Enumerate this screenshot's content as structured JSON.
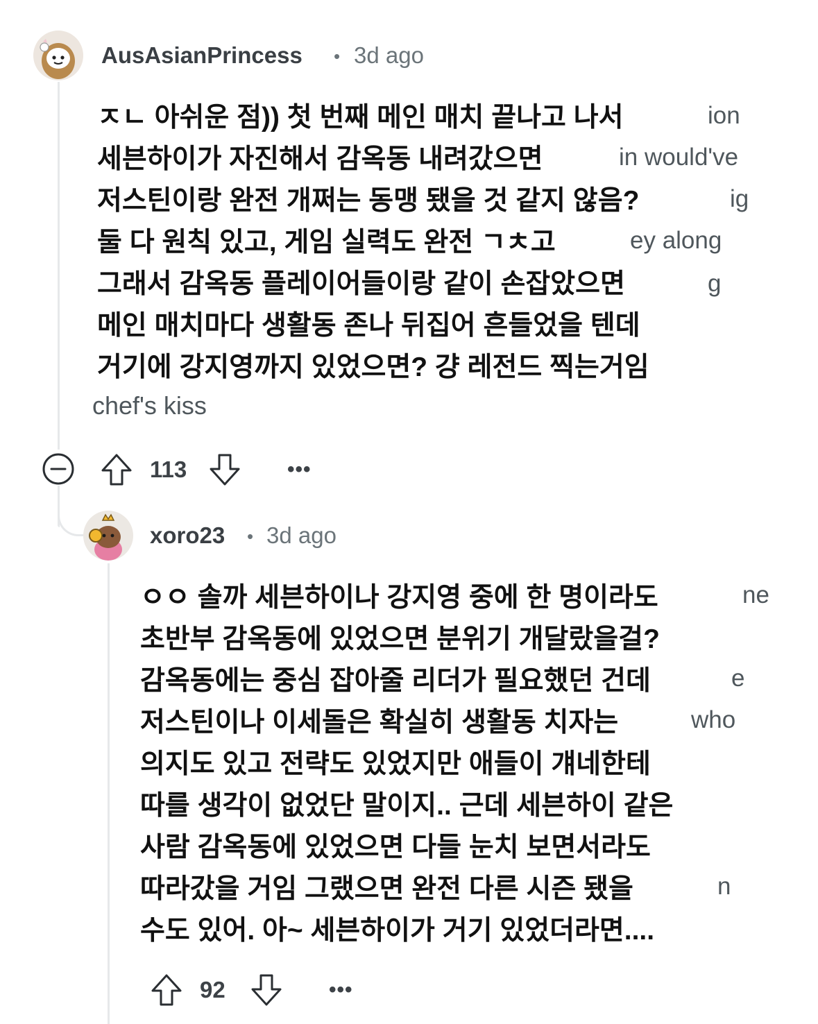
{
  "comments": [
    {
      "author": "AusAsianPrincess",
      "separator": "•",
      "time": "3d ago",
      "body_lines": [
        "ㅈㄴ 아쉬운 점)) 첫 번째 메인 매치 끝나고 나서",
        "세븐하이가 자진해서 감옥동 내려갔으면",
        "저스틴이랑 완전 개쩌는 동맹 됐을 것 같지 않음?",
        "둘 다 원칙 있고, 게임 실력도 완전 ㄱㅊ고",
        "그래서 감옥동 플레이어들이랑 같이 손잡았으면",
        "메인 매치마다 생활동 존나 뒤집어 흔들었을 텐데",
        "거기에 강지영까지 있었으면? 걍 레전드 찍는거임"
      ],
      "ghost_fragments": [
        "ion",
        "in would've",
        "ig",
        "ey along",
        "g"
      ],
      "tail_text": "chef's kiss",
      "upvotes": "113",
      "icons": [
        "collapse-icon",
        "upvote-icon",
        "downvote-icon",
        "more-options-icon"
      ]
    },
    {
      "author": "xoro23",
      "separator": "•",
      "time": "3d ago",
      "body_lines": [
        "ㅇㅇ 솔까 세븐하이나 강지영 중에 한 명이라도",
        "초반부 감옥동에 있었으면 분위기 개달랐을걸?",
        "감옥동에는 중심 잡아줄 리더가 필요했던 건데",
        "저스틴이나 이세돌은 확실히 생활동 치자는",
        "의지도 있고 전략도 있었지만 애들이 걔네한테",
        "따를 생각이 없었단 말이지.. 근데 세븐하이 같은",
        "사람 감옥동에 있었으면 다들 눈치 보면서라도",
        "따라갔을 거임 그랬으면 완전 다른 시즌 됐을",
        "수도 있어. 아~ 세븐하이가 거기 있었더라면...."
      ],
      "ghost_fragments": [
        "ne",
        "e",
        "who",
        "n"
      ],
      "upvotes": "92",
      "icons": [
        "upvote-icon",
        "downvote-icon",
        "more-options-icon"
      ]
    }
  ],
  "more_label": "•••",
  "colors": {
    "thread_line": "#e6e8ea",
    "meta": "#6b7479",
    "text": "#111111"
  }
}
